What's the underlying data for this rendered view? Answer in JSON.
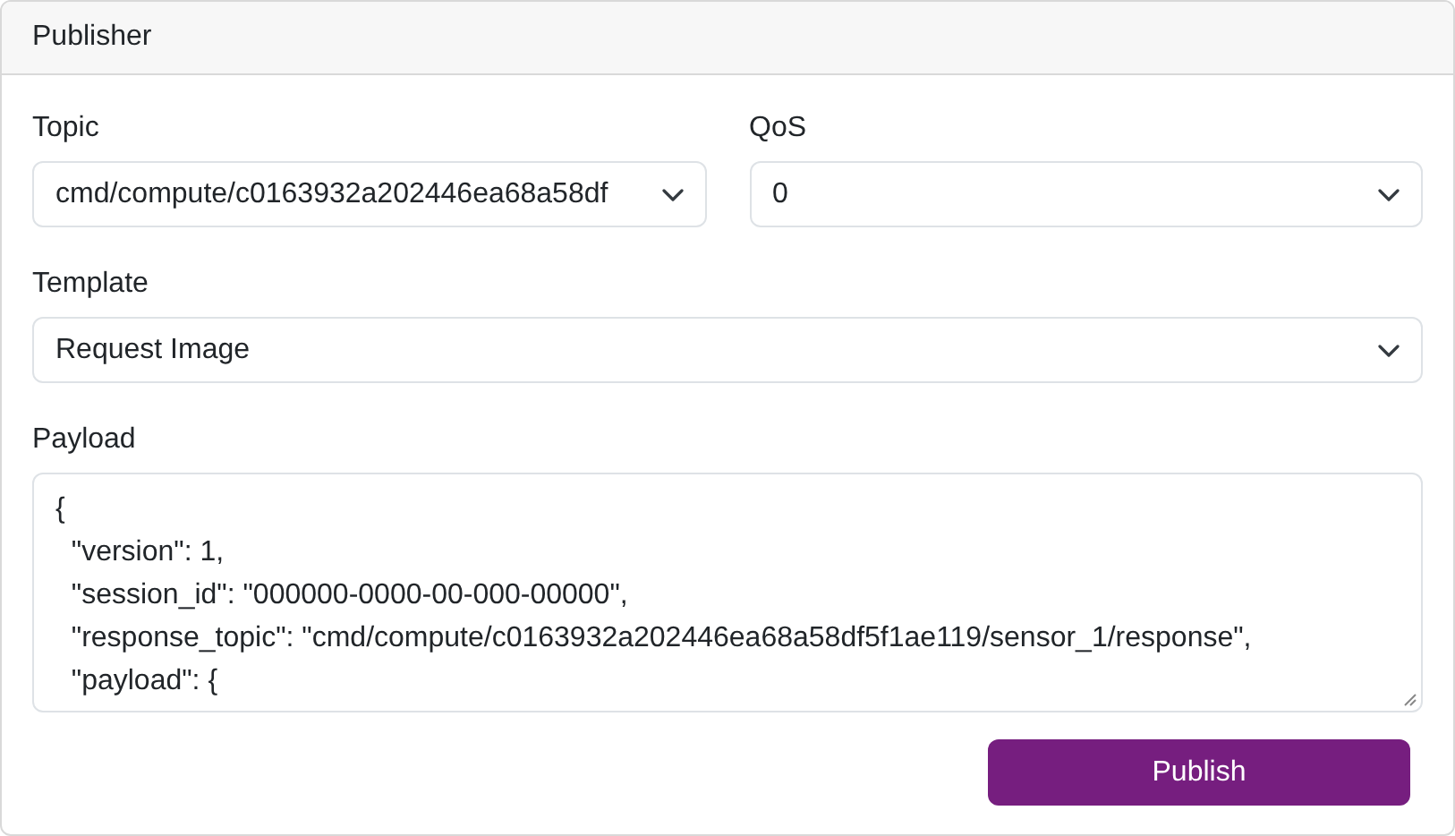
{
  "card": {
    "title": "Publisher"
  },
  "topic": {
    "label": "Topic",
    "value": "cmd/compute/c0163932a202446ea68a58df"
  },
  "qos": {
    "label": "QoS",
    "value": "0"
  },
  "template": {
    "label": "Template",
    "value": "Request Image"
  },
  "payload": {
    "label": "Payload",
    "lines": [
      "{",
      "  \"version\": 1,",
      "  \"session_id\": \"000000-0000-00-000-00000\",",
      "  \"response_topic\": \"cmd/compute/c0163932a202446ea68a58df5f1ae119/sensor_1/response\",",
      "  \"payload\": {"
    ]
  },
  "publish_button": {
    "label": "Publish"
  }
}
